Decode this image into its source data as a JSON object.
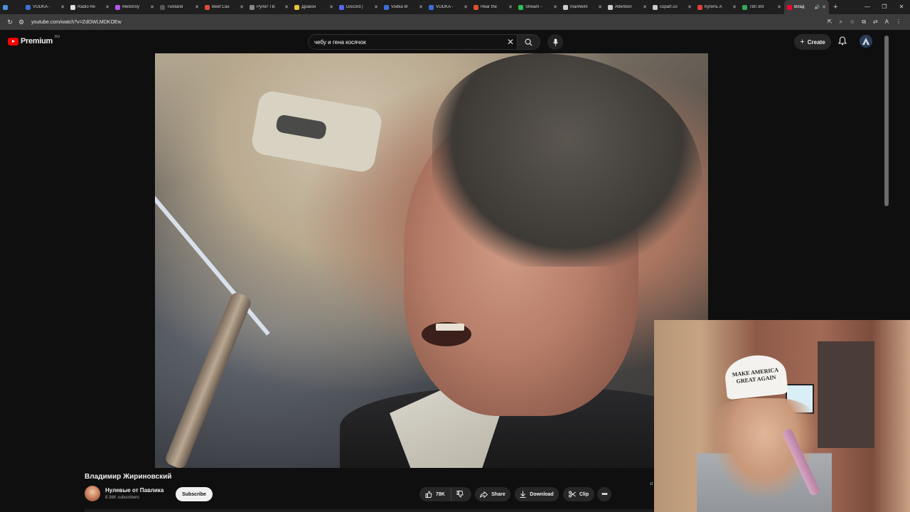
{
  "browser": {
    "tabs": [
      {
        "label": "",
        "color": "#4a90e2"
      },
      {
        "label": "VODKA -",
        "color": "#3b6fd8"
      },
      {
        "label": "Radio Re",
        "color": "#dddddd"
      },
      {
        "label": "Mellstroy",
        "color": "#b455f0"
      },
      {
        "label": "Twstand",
        "color": "#555555"
      },
      {
        "label": "Beef Cas",
        "color": "#e04a3a"
      },
      {
        "label": "Рулет ТВ",
        "color": "#888888"
      },
      {
        "label": "Дракон",
        "color": "#e6c33a"
      },
      {
        "label": "Discord |",
        "color": "#5865f2"
      },
      {
        "label": "Vodka M",
        "color": "#3b6fd8"
      },
      {
        "label": "VODKA -",
        "color": "#3b6fd8"
      },
      {
        "label": "Hear the",
        "color": "#e0502d"
      },
      {
        "label": "Stream -",
        "color": "#2dbd5a"
      },
      {
        "label": "manheim",
        "color": "#cccccc"
      },
      {
        "label": "Attention",
        "color": "#cccccc"
      },
      {
        "label": "copart.co",
        "color": "#cccccc"
      },
      {
        "label": "Купить А",
        "color": "#e0403a"
      },
      {
        "label": "780 3rd",
        "color": "#34a853"
      },
      {
        "label": "Влад",
        "color": "#ff0033",
        "active": true
      }
    ],
    "url": "youtube.com/watch?v=ZdOWLMDKOEw"
  },
  "youtube": {
    "logo_text": "Premium",
    "region": "RU",
    "search_query": "чебу и гена косячок",
    "create_label": "Create"
  },
  "video": {
    "title": "Владимир Жириновский",
    "channel_name": "Нулевые от Павлика",
    "subscribers": "8.36K subscribers",
    "subscribe_label": "Subscribe",
    "likes": "78K",
    "share_label": "Share",
    "download_label": "Download",
    "clip_label": "Clip",
    "edge_text": "cl"
  },
  "webcam": {
    "cap_line1": "MAKE AMERICA",
    "cap_line2": "GREAT AGAIN"
  }
}
